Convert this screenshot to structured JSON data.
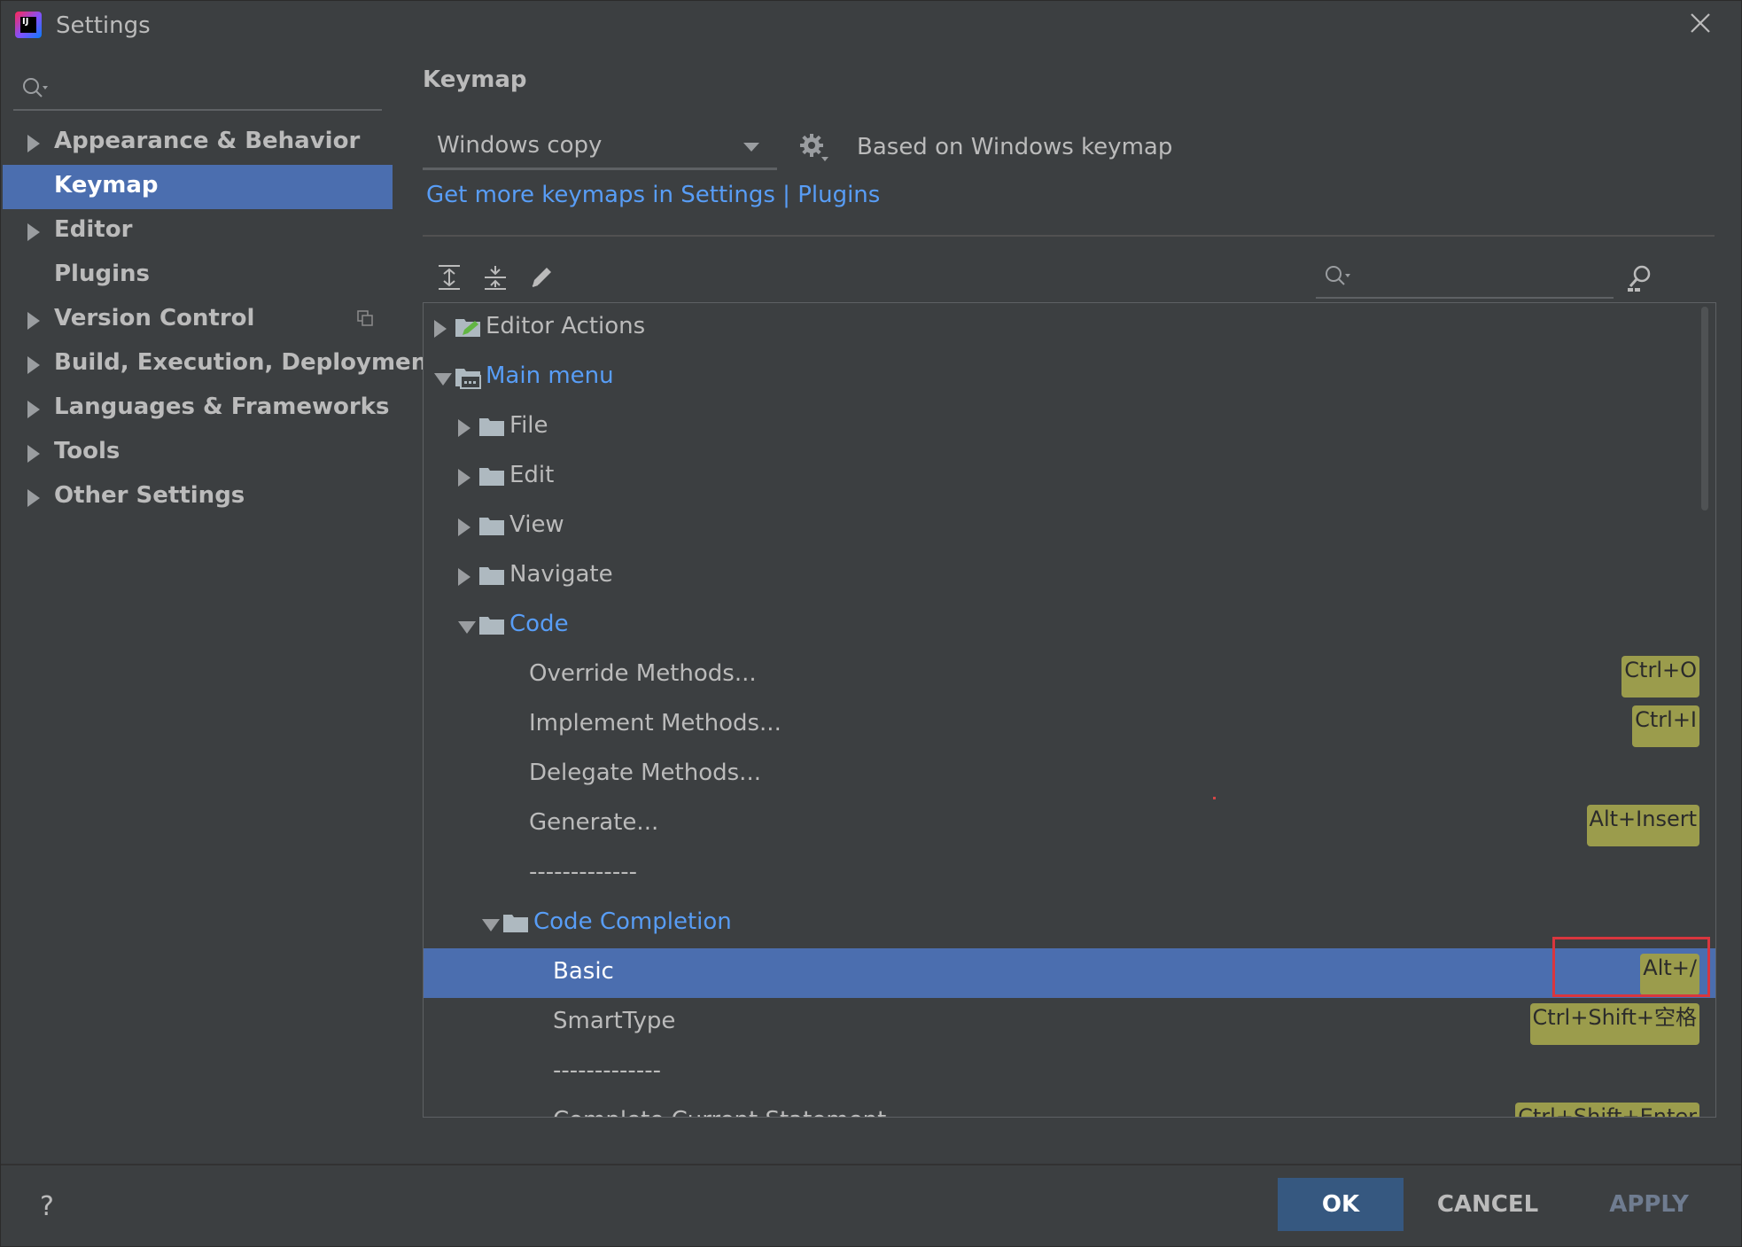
{
  "window": {
    "title": "Settings"
  },
  "sidebar": {
    "items": [
      {
        "label": "Appearance & Behavior",
        "expandable": true
      },
      {
        "label": "Keymap",
        "expandable": false,
        "selected": true
      },
      {
        "label": "Editor",
        "expandable": true
      },
      {
        "label": "Plugins",
        "expandable": false
      },
      {
        "label": "Version Control",
        "expandable": true
      },
      {
        "label": "Build, Execution, Deployment",
        "expandable": true
      },
      {
        "label": "Languages & Frameworks",
        "expandable": true
      },
      {
        "label": "Tools",
        "expandable": true
      },
      {
        "label": "Other Settings",
        "expandable": true
      }
    ]
  },
  "keymap": {
    "title": "Keymap",
    "selected": "Windows copy",
    "based_on": "Based on Windows keymap",
    "more_link": "Get more keymaps in Settings | Plugins"
  },
  "tree": {
    "rows": [
      {
        "label": "Editor Actions",
        "level": 0,
        "expander": "closed",
        "icon": "editor-actions-icon"
      },
      {
        "label": "Main menu",
        "level": 0,
        "expander": "open",
        "icon": "main-menu-folder-icon",
        "blue": true
      },
      {
        "label": "File",
        "level": 1,
        "expander": "closed",
        "icon": "folder-icon"
      },
      {
        "label": "Edit",
        "level": 1,
        "expander": "closed",
        "icon": "folder-icon"
      },
      {
        "label": "View",
        "level": 1,
        "expander": "closed",
        "icon": "folder-icon"
      },
      {
        "label": "Navigate",
        "level": 1,
        "expander": "closed",
        "icon": "folder-icon"
      },
      {
        "label": "Code",
        "level": 1,
        "expander": "open",
        "icon": "folder-icon",
        "blue": true
      },
      {
        "label": "Override Methods...",
        "level": 2,
        "shortcut": "Ctrl+O"
      },
      {
        "label": "Implement Methods...",
        "level": 2,
        "shortcut": "Ctrl+I"
      },
      {
        "label": "Delegate Methods...",
        "level": 2
      },
      {
        "label": "Generate...",
        "level": 2,
        "shortcut": "Alt+Insert"
      },
      {
        "label": "-------------",
        "level": 2
      },
      {
        "label": "Code Completion",
        "level": 2,
        "expander": "open",
        "icon": "folder-icon",
        "blue": true
      },
      {
        "label": "Basic",
        "level": 3,
        "shortcut": "Alt+/",
        "selected": true
      },
      {
        "label": "SmartType",
        "level": 3,
        "shortcut": "Ctrl+Shift+空格"
      },
      {
        "label": "-------------",
        "level": 3
      },
      {
        "label": "Complete Current Statement",
        "level": 3,
        "shortcut": "Ctrl+Shift+Enter"
      }
    ]
  },
  "footer": {
    "help": "?",
    "ok": "OK",
    "cancel": "CANCEL",
    "apply": "APPLY"
  },
  "colors": {
    "selection": "#4b6eaf",
    "link": "#589df6",
    "shortcut_bg": "#9b9c4c",
    "ok_bg": "#365880",
    "highlight_box": "#d9363e"
  }
}
